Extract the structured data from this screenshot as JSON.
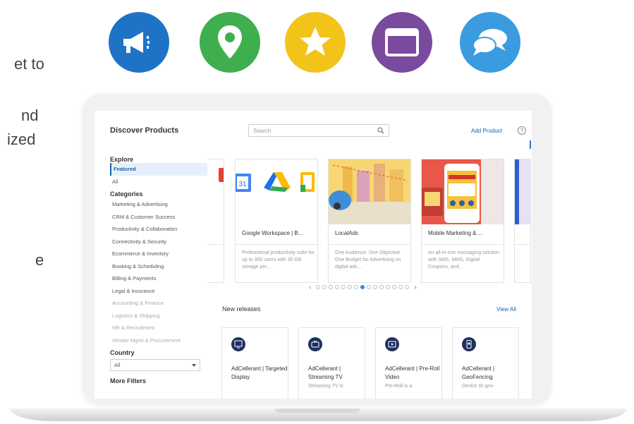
{
  "marketing_text": [
    "et to",
    "nd",
    "ized",
    "e"
  ],
  "feature_icons": [
    {
      "name": "megaphone-icon",
      "color": "#1f73c7"
    },
    {
      "name": "location-pin-icon",
      "color": "#3fae4e"
    },
    {
      "name": "star-icon",
      "color": "#f2c319"
    },
    {
      "name": "browser-window-icon",
      "color": "#7a4a9e"
    },
    {
      "name": "chat-bubbles-icon",
      "color": "#3b9be0"
    }
  ],
  "app": {
    "title": "Discover Products",
    "search_placeholder": "Search",
    "add_product_label": "Add Product",
    "help_label": "?"
  },
  "sidebar": {
    "explore_heading": "Explore",
    "explore_items": [
      {
        "label": "Featured",
        "active": true
      },
      {
        "label": "All",
        "active": false
      }
    ],
    "categories_heading": "Categories",
    "categories": [
      {
        "label": "Marketing & Advertising",
        "dim": false
      },
      {
        "label": "CRM & Customer Success",
        "dim": false
      },
      {
        "label": "Productivity & Collaboration",
        "dim": false
      },
      {
        "label": "Connectivity & Security",
        "dim": false
      },
      {
        "label": "Ecommerce & Inventory",
        "dim": false
      },
      {
        "label": "Booking & Scheduling",
        "dim": false
      },
      {
        "label": "Billing & Payments",
        "dim": false
      },
      {
        "label": "Legal & Insurance",
        "dim": false
      },
      {
        "label": "Accounting & Finance",
        "dim": true
      },
      {
        "label": "Logistics & Shipping",
        "dim": true
      },
      {
        "label": "HR & Recruitment",
        "dim": true
      },
      {
        "label": "Vendor Mgmt & Procurement",
        "dim": true
      }
    ],
    "country_heading": "Country",
    "country_value": "All",
    "more_filters_label": "More Filters"
  },
  "featured": [
    {
      "title": "Google Workspace | B...",
      "description": "Professional productivity suite for up to 300 users with 30 GB storage per..."
    },
    {
      "title": "LocalAds",
      "description": "One Audience. One Objective. One Budget for Advertising on digital ads..."
    },
    {
      "title": "Mobile Marketing & ...",
      "description": "An all-in-one messaging solution with SMS, MMS, Digital Coupons, and..."
    }
  ],
  "carousel": {
    "count": 15,
    "active_index": 7,
    "prev": "‹",
    "next": "›"
  },
  "new_releases": {
    "heading": "New releases",
    "view_all_label": "View All",
    "items": [
      {
        "name": "AdCellerant | Targeted Display",
        "description": ""
      },
      {
        "name": "AdCellerant | Streaming TV",
        "description": "Streaming TV is"
      },
      {
        "name": "AdCellerant | Pre-Roll Video",
        "description": "Pre-Roll is a"
      },
      {
        "name": "AdCellerant | GeoFencing",
        "description": "Device ID geo-"
      }
    ]
  },
  "google_tile": {
    "calendar_number": "31"
  }
}
